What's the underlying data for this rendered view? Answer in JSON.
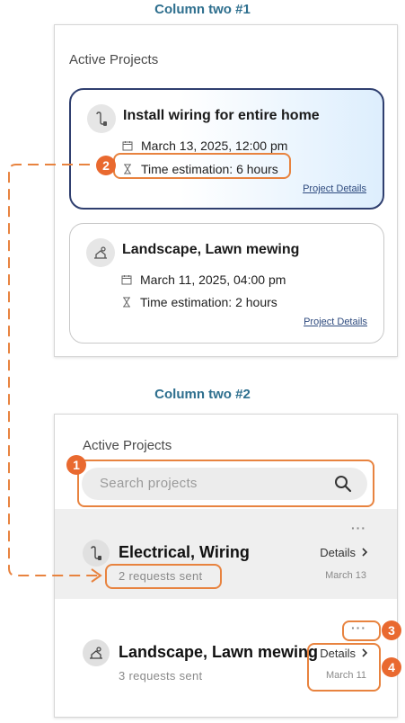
{
  "column1": {
    "title": "Column two #1",
    "panel_title": "Active Projects",
    "cards": [
      {
        "title": "Install wiring for entire home",
        "date": "March 13, 2025, 12:00 pm",
        "estimate": "Time estimation: 6 hours",
        "link": "Project Details",
        "icon": "plug-icon",
        "active": true
      },
      {
        "title": "Landscape, Lawn mewing",
        "date": "March 11, 2025, 04:00 pm",
        "estimate": "Time estimation: 2 hours",
        "link": "Project Details",
        "icon": "landscape-icon",
        "active": false
      }
    ]
  },
  "column2": {
    "title": "Column two #2",
    "panel_title": "Active Projects",
    "search": {
      "placeholder": "Search projects"
    },
    "rows": [
      {
        "title": "Electrical, Wiring",
        "subtitle": "2 requests sent",
        "details": "Details",
        "date": "March 13",
        "more": "···",
        "icon": "plug-icon",
        "selected": true
      },
      {
        "title": "Landscape, Lawn mewing",
        "subtitle": "3 requests sent",
        "details": "Details",
        "date": "March 11",
        "more": "···",
        "icon": "landscape-icon",
        "selected": false
      }
    ]
  },
  "annotations": [
    "1",
    "2",
    "3",
    "4"
  ],
  "colors": {
    "accent": "#e9692f",
    "title": "#2e6f8e",
    "active_border": "#2f3f6f"
  }
}
